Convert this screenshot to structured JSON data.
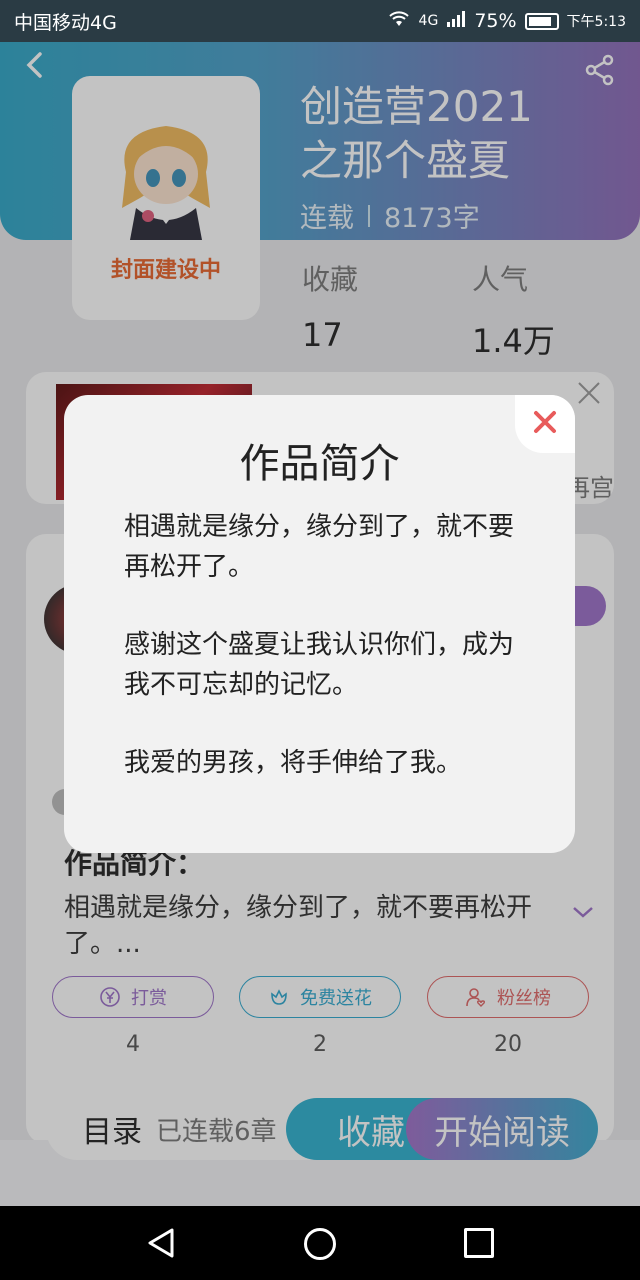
{
  "status_bar": {
    "carrier": "中国移动4G",
    "signal_tag": "4G",
    "battery": "75%",
    "time": "下午5:13"
  },
  "book": {
    "cover_label": "封面建设中",
    "title_line1": "创造营2021",
    "title_line2": "之那个盛夏",
    "status": "连载",
    "word_count": "8173字",
    "fav_label": "收藏",
    "fav_value": "17",
    "pop_label": "人气",
    "pop_value": "1.4万"
  },
  "behind": {
    "card_tail_text": "再宫",
    "intro_heading": "作品简介：",
    "intro_preview": "相遇就是缘分，缘分到了，就不要再松开了。...",
    "actions": [
      {
        "label": "打赏",
        "count": "4",
        "color": "#9b6fc8"
      },
      {
        "label": "免费送花",
        "count": "2",
        "color": "#2fa8cf"
      },
      {
        "label": "粉丝榜",
        "count": "20",
        "color": "#e06666"
      }
    ]
  },
  "bottom": {
    "toc_label": "目录",
    "toc_sub": "已连载6章",
    "fav_button": "收藏",
    "read_button": "开始阅读"
  },
  "modal": {
    "title": "作品简介",
    "paragraphs": [
      "相遇就是缘分，缘分到了，就不要再松开了。",
      "感谢这个盛夏让我认识你们，成为我不可忘却的记忆。",
      "我爱的男孩，将手伸给了我。"
    ]
  },
  "colors": {
    "accent_blue": "#2fa6c6",
    "accent_purple": "#8e6ab8",
    "close_red": "#e85b5b"
  },
  "icons": [
    "back-icon",
    "share-icon",
    "close-icon",
    "yen-icon",
    "flower-icon",
    "fan-icon",
    "chevron-down-icon",
    "nav-back-icon",
    "nav-home-icon",
    "nav-recent-icon"
  ]
}
